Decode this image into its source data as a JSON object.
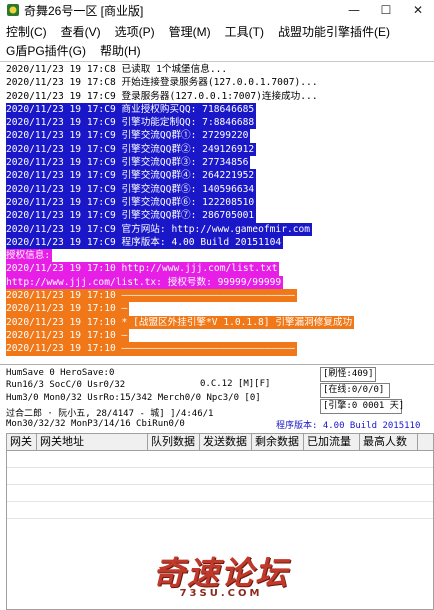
{
  "window": {
    "title": "奇舞26号一区 [商业版]",
    "minimize_glyph": "—",
    "maximize_glyph": "☐",
    "close_glyph": "✕"
  },
  "menu": {
    "row1": [
      "控制(C)",
      "查看(V)",
      "选项(P)",
      "管理(M)",
      "工具(T)",
      "战盟功能引擎插件(E)"
    ],
    "row2": [
      "G盾PG插件(G)",
      "帮助(H)"
    ]
  },
  "log": {
    "lines": [
      {
        "text": "2020/11/23 19 17:C8 已读取 1个城堡信息...",
        "bg": "",
        "fg": "#000000"
      },
      {
        "text": "2020/11/23 19 17:C8 开始连接登录服务器(127.0.0.1.7007)...",
        "bg": "",
        "fg": "#000000"
      },
      {
        "text": "2020/11/23 19 17:C9 登录服务器(127.0.0.1:7007)连接成功...",
        "bg": "",
        "fg": "#000000"
      },
      {
        "text": "2020/11/23 19 17:C9 商业授权购买QQ: 718646685",
        "bg": "#1a17c9",
        "fg": "#ffffff"
      },
      {
        "text": "2020/11/23 19 17:C9 引擎功能定制QQ: 7:8846688",
        "bg": "#1a17c9",
        "fg": "#ffffff"
      },
      {
        "text": "2020/11/23 19 17:C9 引擎交流QQ群①: 27299220",
        "bg": "#1a17c9",
        "fg": "#ffffff"
      },
      {
        "text": "2020/11/23 19 17:C9 引擎交流QQ群②: 249126912",
        "bg": "#1a17c9",
        "fg": "#ffffff"
      },
      {
        "text": "2020/11/23 19 17:C9 引擎交流QQ群③: 27734856",
        "bg": "#1a17c9",
        "fg": "#ffffff"
      },
      {
        "text": "2020/11/23 19 17:C9 引擎交流QQ群④: 264221952",
        "bg": "#1a17c9",
        "fg": "#ffffff"
      },
      {
        "text": "2020/11/23 19 17:C9 引擎交流QQ群⑤: 140596634",
        "bg": "#1a17c9",
        "fg": "#ffffff"
      },
      {
        "text": "2020/11/23 19 17:C9 引擎交流QQ群⑥: 122208510",
        "bg": "#1a17c9",
        "fg": "#ffffff"
      },
      {
        "text": "2020/11/23 19 17:C9 引擎交流QQ群⑦: 286705001",
        "bg": "#1a17c9",
        "fg": "#ffffff"
      },
      {
        "text": "2020/11/23 19 17:C9 官方网站: http://www.gameofmir.com",
        "bg": "#1a17c9",
        "fg": "#ffffff"
      },
      {
        "text": "2020/11/23 19 17:C9 程序版本: 4.00 Build 20151104",
        "bg": "#1a17c9",
        "fg": "#ffffff"
      },
      {
        "text": "授权信息:",
        "bg": "#e61ee6",
        "fg": "#ffffff"
      },
      {
        "text": "2020/11/23 19 17:10 http://www.jjj.com/list.txt",
        "bg": "#e61ee6",
        "fg": "#ffffff"
      },
      {
        "text": "http://www.jjj.com/list.tx: 授权号数: 99999/99999",
        "bg": "#e61ee6",
        "fg": "#ffffff"
      },
      {
        "text": "2020/11/23 19 17:10 ——————————————————————————————",
        "bg": "#f07818",
        "fg": "#ffffff"
      },
      {
        "text": "2020/11/23 19 17:10 —",
        "bg": "#f07818",
        "fg": "#ffffff"
      },
      {
        "text": "2020/11/23 19 17:10 * [战盟区外挂引擎*V 1.0.1.8] 引擎漏洞修复成功",
        "bg": "#f07818",
        "fg": "#ffffff"
      },
      {
        "text": "2020/11/23 19 17:10 —",
        "bg": "#f07818",
        "fg": "#ffffff"
      },
      {
        "text": "2020/11/23 19 17:10 ——————————————————————————————",
        "bg": "#f07818",
        "fg": "#ffffff"
      }
    ]
  },
  "status": {
    "line1": "HumSave 0 HeroSave:0",
    "line2": "Run16/3 SocC/0 Usr0/32",
    "line2b": "0.C.12 [M][F]",
    "line3": "Hum3/0 Mon0/32 UsrRo:15/342 Merch0/0 Npc3/0 [0]",
    "line4": "过合二郎 · 阮小五, 28/4147 - 城] ]/4:46/1",
    "line5": "Mon30/32/32 MonP3/14/16 CbiRun0/0",
    "box_refresh": "[刷怪:409]",
    "box_online": "[在线:0/0/0]",
    "box_engine": "[引擎:0 0001 天]",
    "version": "程序版本: 4.00 Build 2015110"
  },
  "grid": {
    "columns": [
      "网关",
      "网关地址",
      "队列数据",
      "发送数据",
      "剩余数据",
      "已加流量",
      "最高人数"
    ]
  },
  "watermark": {
    "title": "奇速论坛",
    "subtitle": "73SU.COM"
  },
  "colors": {
    "blue_highlight": "#1a17c9",
    "magenta_highlight": "#e61ee6",
    "orange_highlight": "#f07818",
    "version_text": "#1a17c9",
    "watermark_red": "#c0392b"
  }
}
